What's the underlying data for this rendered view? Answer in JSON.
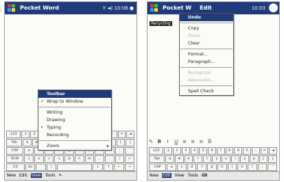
{
  "left": {
    "title": "Pocket Word",
    "status": "10:06",
    "view_menu": {
      "items": [
        {
          "label": "Toolbar",
          "highlighted": true
        },
        {
          "label": "Wrap to Window",
          "checked": true
        },
        {
          "label": "Writing"
        },
        {
          "label": "Drawing"
        },
        {
          "label": "Typing",
          "checked": true
        },
        {
          "label": "Recording"
        },
        {
          "label": "Zoom",
          "submenu": true
        }
      ]
    },
    "menubar": [
      "New",
      "Edit",
      "View",
      "Tools"
    ]
  },
  "right": {
    "title": "Pocket W",
    "menu_title": "Edit",
    "status": "10:03",
    "selected_word": "Recycling",
    "edit_menu": {
      "items": [
        {
          "label": "Undo",
          "highlighted": true
        },
        {
          "label": "Copy"
        },
        {
          "label": "Paste",
          "disabled": true
        },
        {
          "label": "Clear"
        },
        {
          "label": "Format..."
        },
        {
          "label": "Paragraph..."
        },
        {
          "label": "Recognize",
          "disabled": true
        },
        {
          "label": "Alternates...",
          "disabled": true
        },
        {
          "label": "Spell Check"
        }
      ]
    },
    "menubar": [
      "New",
      "Edit",
      "View",
      "Tools"
    ]
  },
  "keyboard_rows": [
    [
      "123",
      "1",
      "2",
      "3",
      "4",
      "5",
      "6",
      "7",
      "8",
      "9",
      "0",
      "-",
      "=",
      "◄"
    ],
    [
      "Tab",
      "q",
      "w",
      "e",
      "r",
      "t",
      "y",
      "u",
      "i",
      "o",
      "p",
      "[",
      "]"
    ],
    [
      "CAP",
      "a",
      "s",
      "d",
      "f",
      "g",
      "h",
      "j",
      "k",
      "l",
      ";",
      "'"
    ],
    [
      "Shift",
      "z",
      "x",
      "c",
      "v",
      "b",
      "n",
      "m",
      ",",
      ".",
      "/",
      "←"
    ],
    [
      "Ctl",
      "áü",
      "`",
      "\\",
      " ",
      "↓",
      "↑",
      "←",
      "→"
    ]
  ],
  "colors": {
    "titlebar": "#1f3b7a",
    "highlight": "#1f3b7a"
  }
}
